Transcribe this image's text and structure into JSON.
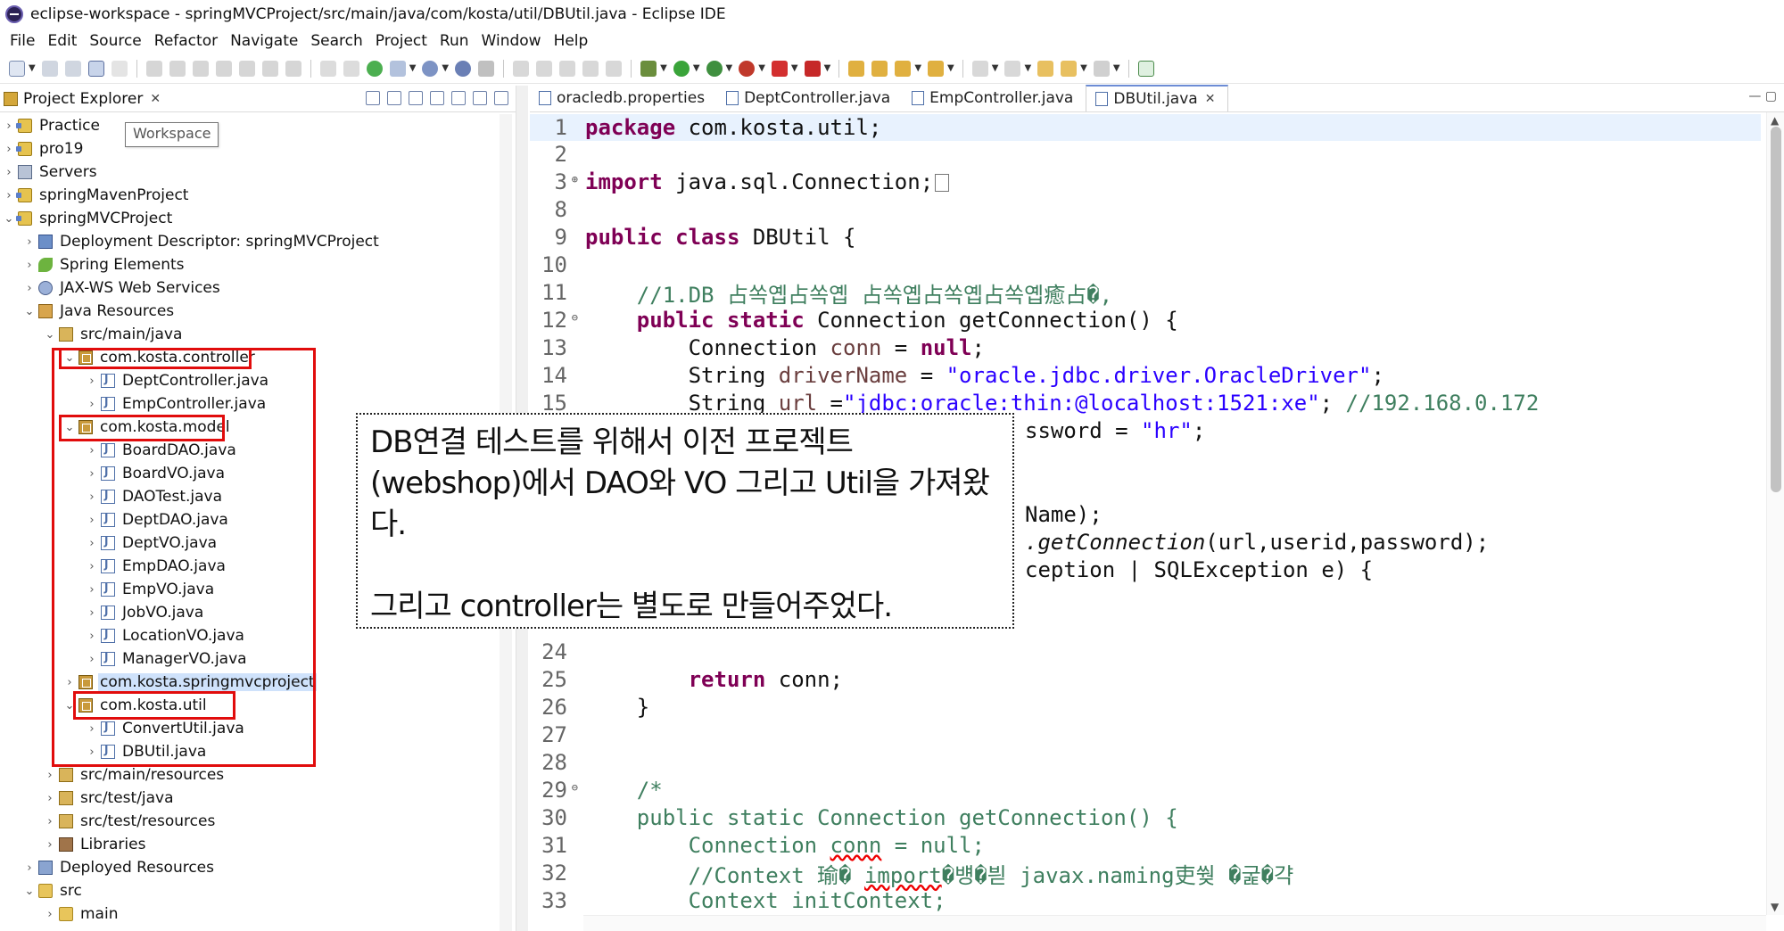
{
  "window": {
    "title": "eclipse-workspace - springMVCProject/src/main/java/com/kosta/util/DBUtil.java - Eclipse IDE"
  },
  "menu": [
    "File",
    "Edit",
    "Source",
    "Refactor",
    "Navigate",
    "Search",
    "Project",
    "Run",
    "Window",
    "Help"
  ],
  "explorer": {
    "title": "Project Explorer",
    "close": "✕",
    "tooltip": "Workspace",
    "items": [
      {
        "label": "Practice"
      },
      {
        "label": "pro19"
      },
      {
        "label": "Servers"
      },
      {
        "label": "springMavenProject"
      },
      {
        "label": "springMVCProject"
      },
      {
        "label": "Deployment Descriptor: springMVCProject"
      },
      {
        "label": "Spring Elements"
      },
      {
        "label": "JAX-WS Web Services"
      },
      {
        "label": "Java Resources"
      },
      {
        "label": "src/main/java"
      },
      {
        "label": "com.kosta.controller"
      },
      {
        "label": "DeptController.java"
      },
      {
        "label": "EmpController.java"
      },
      {
        "label": "com.kosta.model"
      },
      {
        "label": "BoardDAO.java"
      },
      {
        "label": "BoardVO.java"
      },
      {
        "label": "DAOTest.java"
      },
      {
        "label": "DeptDAO.java"
      },
      {
        "label": "DeptVO.java"
      },
      {
        "label": "EmpDAO.java"
      },
      {
        "label": "EmpVO.java"
      },
      {
        "label": "JobVO.java"
      },
      {
        "label": "LocationVO.java"
      },
      {
        "label": "ManagerVO.java"
      },
      {
        "label": "com.kosta.springmvcproject"
      },
      {
        "label": "com.kosta.util"
      },
      {
        "label": "ConvertUtil.java"
      },
      {
        "label": "DBUtil.java"
      },
      {
        "label": "src/main/resources"
      },
      {
        "label": "src/test/java"
      },
      {
        "label": "src/test/resources"
      },
      {
        "label": "Libraries"
      },
      {
        "label": "Deployed Resources"
      },
      {
        "label": "src"
      },
      {
        "label": "main"
      }
    ]
  },
  "editor": {
    "tabs": [
      {
        "label": "oracledb.properties"
      },
      {
        "label": "DeptController.java"
      },
      {
        "label": "EmpController.java"
      },
      {
        "label": "DBUtil.java",
        "close": "✕"
      }
    ],
    "line_numbers": [
      "1",
      "2",
      "3",
      "8",
      "9",
      "10",
      "11",
      "12",
      "13",
      "14",
      "15",
      "",
      "",
      "",
      "",
      "",
      "",
      "",
      "",
      "24",
      "25",
      "26",
      "27",
      "28",
      "29",
      "30",
      "31",
      "32",
      "33"
    ],
    "lines": {
      "l1_kw": "package",
      "l1_rest": " com.kosta.util;",
      "l3_kw": "import",
      "l3_rest": " java.sql.Connection;",
      "l9_kw1": "public",
      "l9_kw2": "class",
      "l9_rest": " DBUtil {",
      "l11_cm": "    //1.DB 占쏙옙占쏙옙 占쏙옙占쏙옙占쏙옙癒占�,",
      "l12_kw1": "public",
      "l12_kw2": "static",
      "l12_rest": " Connection getConnection() {",
      "l13_a": "        Connection ",
      "l13_f": "conn",
      "l13_b": " = ",
      "l13_kw": "null",
      "l13_c": ";",
      "l14_a": "        String ",
      "l14_f": "driverName",
      "l14_b": " = ",
      "l14_s": "\"oracle.jdbc.driver.OracleDriver\"",
      "l14_c": ";",
      "l15_a": "        String ",
      "l15_f": "url",
      "l15_b": " =",
      "l15_s": "\"jdbc:oracle:thin:@localhost:1521:xe\"",
      "l15_c": "; ",
      "l15_cm": "//192.168.0.172",
      "l16_tail": "ssword = ",
      "l16_s": "\"hr\"",
      "l16_c": ";",
      "l19_tail": "Name);",
      "l20_i": ".getConnection",
      "l20_rest": "(url,userid,password);",
      "l21_tail": "ception | SQLException e) {",
      "l25_kw": "return",
      "l25_rest": " conn;",
      "l26": "    }",
      "l29": "    /*",
      "l30": "    public static Connection getConnection() {",
      "l31_a": "        Connection ",
      "l31_u": "conn",
      "l31_b": " = null;",
      "l32_a": "        //Context 瑜� ",
      "l32_u": "import",
      "l32_b": "�뱽�븯 javax.naming吏쒖 �굹�갹",
      "l33": "        Context initContext;"
    }
  },
  "annotation": {
    "line1": "DB연결 테스트를 위해서 이전 프로젝트 (webshop)에서 DAO와 VO 그리고 Util을 가져왔다.",
    "line2": "그리고 controller는 별도로 만들어주었다."
  },
  "colors": {
    "highlight_red": "#e10c0c",
    "keyword": "#7f0055",
    "string": "#2a00ff",
    "comment": "#3f7f5f"
  }
}
